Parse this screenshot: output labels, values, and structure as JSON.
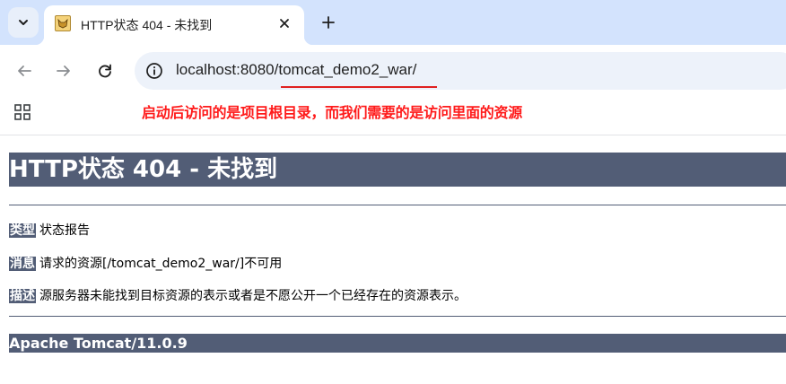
{
  "browser": {
    "tab": {
      "title": "HTTP状态 404 - 未找到"
    },
    "address_bar": {
      "host": "localhost:8080",
      "path": "/tomcat_demo2_war/"
    },
    "annotation": "启动后访问的是项目根目录，而我们需要的是访问里面的资源"
  },
  "page": {
    "heading": "HTTP状态 404 - 未找到",
    "type_label": "类型",
    "type_value": "状态报告",
    "message_label": "消息",
    "message_value": "请求的资源[/tomcat_demo2_war/]不可用",
    "description_label": "描述",
    "description_value": "源服务器未能找到目标资源的表示或者是不愿公开一个已经存在的资源表示。",
    "footer": "Apache Tomcat/11.0.9"
  },
  "colors": {
    "tabstrip": "#d3e3fd",
    "omnibox": "#edf2fa",
    "tomcat_header": "#525d76",
    "annotation": "#ff1a1a"
  },
  "icons": [
    "tab-list-icon",
    "tomcat-favicon-icon",
    "close-icon",
    "plus-icon",
    "back-arrow-icon",
    "forward-arrow-icon",
    "reload-icon",
    "info-icon",
    "apps-grid-icon"
  ]
}
